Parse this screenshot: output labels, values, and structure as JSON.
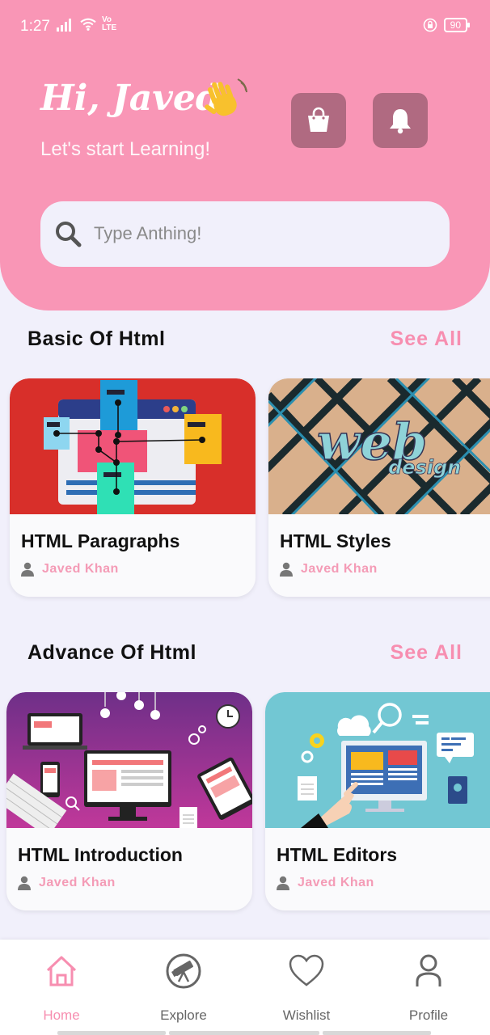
{
  "status": {
    "time": "1:27",
    "network": "Vo LTE",
    "battery": "90"
  },
  "header": {
    "greeting": "Hi, Javed",
    "greeting_emoji": "waving-hand-icon",
    "subtitle": "Let's start Learning!",
    "buttons": [
      "shopping-bag-icon",
      "bell-icon"
    ]
  },
  "search": {
    "placeholder": "Type Anthing!"
  },
  "sections": [
    {
      "title": "Basic Of Html",
      "see_all": "See All",
      "cards": [
        {
          "title": "HTML Paragraphs",
          "author": "Javed Khan"
        },
        {
          "title": "HTML Styles",
          "author": "Javed Khan"
        }
      ]
    },
    {
      "title": "Advance Of Html",
      "see_all": "See All",
      "cards": [
        {
          "title": "HTML Introduction",
          "author": "Javed Khan"
        },
        {
          "title": "HTML Editors",
          "author": "Javed Khan"
        }
      ]
    }
  ],
  "card_images": {
    "styles_text_1": "web",
    "styles_text_2": "design"
  },
  "nav": [
    {
      "label": "Home",
      "icon": "home-icon",
      "active": true
    },
    {
      "label": "Explore",
      "icon": "telescope-icon",
      "active": false
    },
    {
      "label": "Wishlist",
      "icon": "heart-icon",
      "active": false
    },
    {
      "label": "Profile",
      "icon": "user-icon",
      "active": false
    }
  ],
  "colors": {
    "primary": "#F996B6",
    "accent": "#F78EB0",
    "button": "#B06A81",
    "background": "#F1F0FB"
  }
}
